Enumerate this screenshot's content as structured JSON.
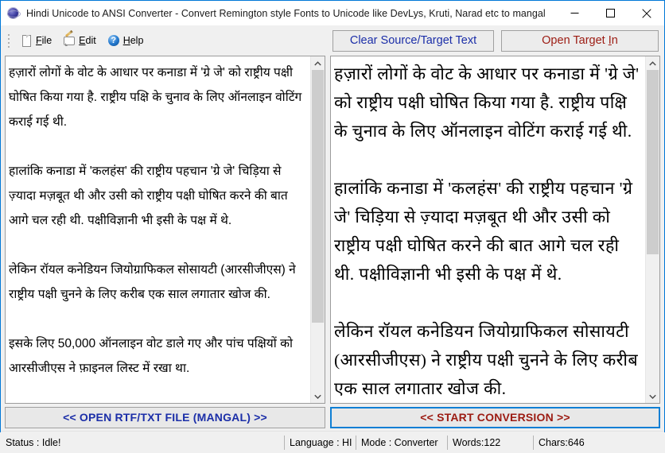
{
  "window": {
    "title": "Hindi Unicode to ANSI Converter - Convert Remington style Fonts to Unicode like DevLys, Kruti, Narad etc to mangal",
    "app_icon": "globe-icon",
    "controls": {
      "minimize": "minimize-icon",
      "maximize": "maximize-icon",
      "close": "close-icon"
    }
  },
  "menu": {
    "items": [
      {
        "label_pre": "",
        "accel": "F",
        "label_post": "ile",
        "icon": "file-page-icon",
        "name": "file"
      },
      {
        "label_pre": "",
        "accel": "E",
        "label_post": "dit",
        "icon": "edit-pencil-icon",
        "name": "edit"
      },
      {
        "label_pre": "",
        "accel": "H",
        "label_post": "elp",
        "icon": "help-question-icon",
        "name": "help"
      }
    ]
  },
  "toolbar": {
    "clear_button": "Clear Source/Target Text",
    "open_target_pre": "Open Target ",
    "open_target_accel": "I",
    "open_target_post": "n"
  },
  "source_panel": {
    "text": "हज़ारों लोगों के वोट के आधार पर कनाडा में 'ग्रे जे' को राष्ट्रीय पक्षी घोषित किया गया है. राष्ट्रीय पक्षि के चुनाव के लिए ऑनलाइन वोटिंग कराई गई थी.\n\nहालांकि कनाडा में 'कलहंस' की राष्ट्रीय पहचान 'ग्रे जे' चिड़िया से ज़्यादा मज़बूत थी और उसी को राष्ट्रीय पक्षी घोषित करने की बात आगे चल रही थी. पक्षीविज्ञानी भी इसी के पक्ष में थे.\n\nलेकिन रॉयल कनेडियन जियोग्राफिकल सोसायटी (आरसीजीएस) ने राष्ट्रीय पक्षी चुनने के लिए करीब एक साल लगातार खोज की.\n\nइसके लिए 50,000 ऑनलाइन वोट डाले गए और पांच पक्षियों को आरसीजीएस ने फ़ाइनल लिस्ट में रखा था.",
    "scrollbar": {
      "up_arrow": "chevron-up-icon",
      "down_arrow": "chevron-down-icon",
      "thumb_top_pct": 0,
      "thumb_height_pct": 85
    }
  },
  "target_panel": {
    "text": "हज़ारों लोगों के वोट के आधार पर कनाडा में 'ग्रे जे' को राष्ट्रीय पक्षी घोषित किया गया है. राष्ट्रीय पक्षि के चुनाव के लिए ऑनलाइन वोटिंग कराई गई थी.\n\nहालांकि कनाडा में 'कलहंस' की राष्ट्रीय पहचान 'ग्रे जे' चिड़िया से ज़्यादा मज़बूत थी और उसी को राष्ट्रीय पक्षी घोषित करने की बात आगे चल रही थी. पक्षीविज्ञानी भी इसी के पक्ष में थे.\n\nलेकिन रॉयल कनेडियन जियोग्राफिकल सोसायटी (आरसीजीएस) ने राष्ट्रीय पक्षी चुनने के लिए करीब एक साल लगातार खोज की.",
    "scrollbar": {
      "up_arrow": "chevron-up-icon",
      "down_arrow": "chevron-down-icon",
      "thumb_top_pct": 0,
      "thumb_height_pct": 62
    }
  },
  "actions": {
    "open_rtf_button": "<< OPEN RTF/TXT FILE (MANGAL) >>",
    "start_conversion_button": "<< START CONVERSION >>"
  },
  "status_bar": {
    "status": "Status :  Idle!",
    "language": "Language : HI",
    "mode": "Mode : Converter",
    "words": "Words:122",
    "chars": "Chars:646"
  },
  "colors": {
    "window_border": "#0078d7",
    "blue_text": "#1b2ea8",
    "red_text": "#9c1b12",
    "focus_border": "#0f7fd4",
    "button_face": "#e8e8e8",
    "toolbar_bg": "#f0f0f0"
  }
}
